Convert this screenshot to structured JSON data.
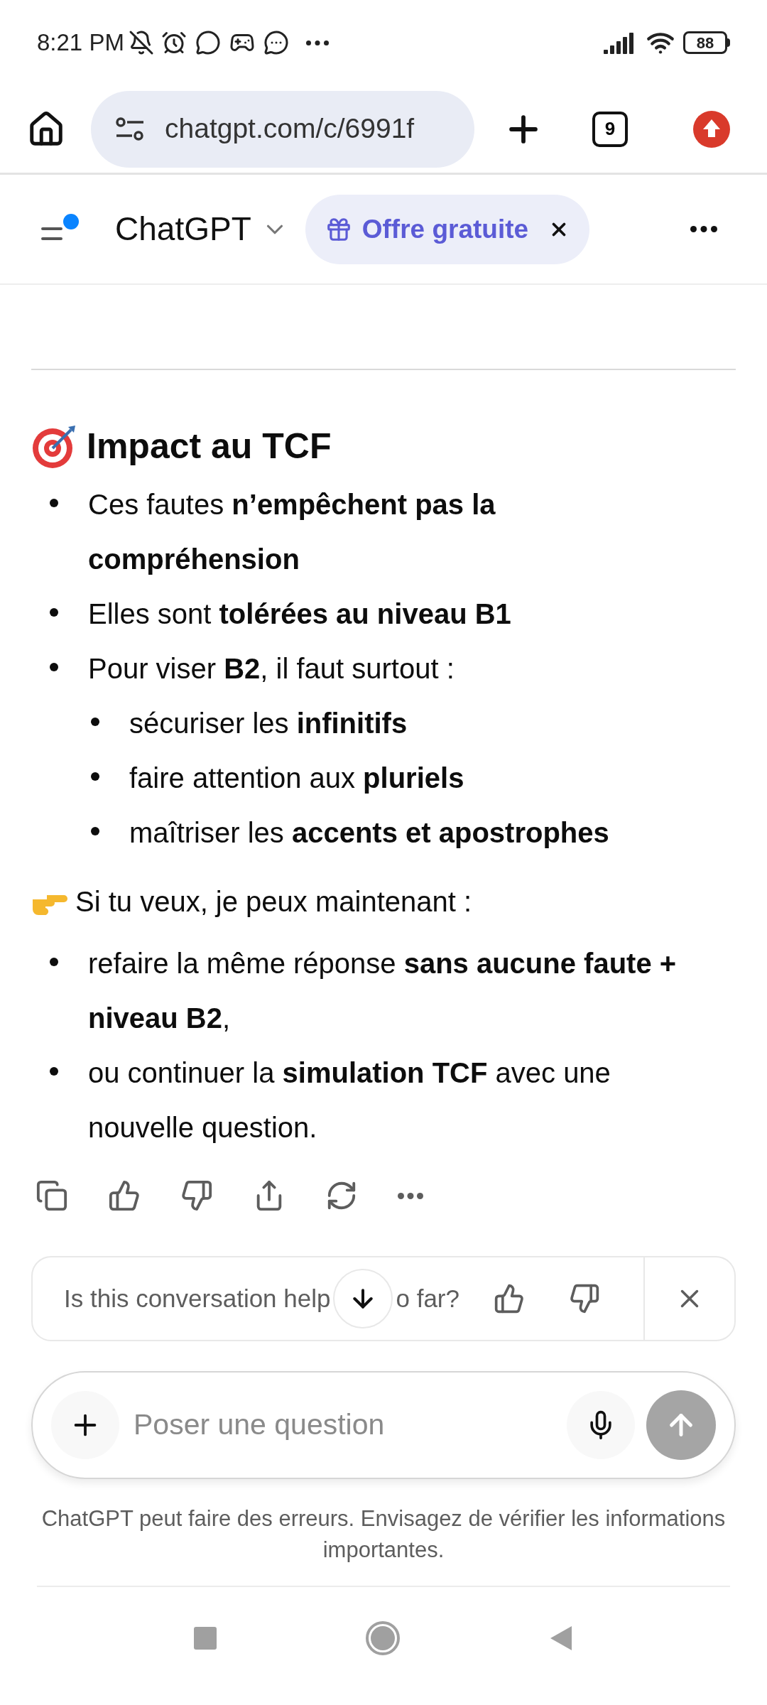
{
  "status_bar": {
    "time": "8:21 PM",
    "battery": "88"
  },
  "browser": {
    "url": "chatgpt.com/c/6991f",
    "tab_count": "9"
  },
  "header": {
    "title": "ChatGPT",
    "promo": "Offre gratuite"
  },
  "message": {
    "heading": "Impact au TCF",
    "bullets": [
      {
        "text": "Ces fautes **n’empêchent pas la compréhension**"
      },
      {
        "text": "Elles sont **tolérées au niveau B1**"
      },
      {
        "text": "Pour viser **B2**, il faut surtout :",
        "children": [
          {
            "text": "sécuriser les **infinitifs**"
          },
          {
            "text": "faire attention aux **pluriels**"
          },
          {
            "text": "maîtriser les **accents et apostrophes**"
          }
        ]
      }
    ],
    "prompt": "Si tu veux, je peux maintenant :",
    "options": [
      {
        "text": "refaire la même réponse **sans aucune faute + niveau B2**,"
      },
      {
        "text": "ou continuer la **simulation TCF** avec une nouvelle question."
      }
    ]
  },
  "feedback": {
    "question_start": "Is this conversation help",
    "question_end": "o far?"
  },
  "composer": {
    "placeholder": "Poser une question"
  },
  "disclaimer": "ChatGPT peut faire des erreurs. Envisagez de vérifier les informations importantes."
}
